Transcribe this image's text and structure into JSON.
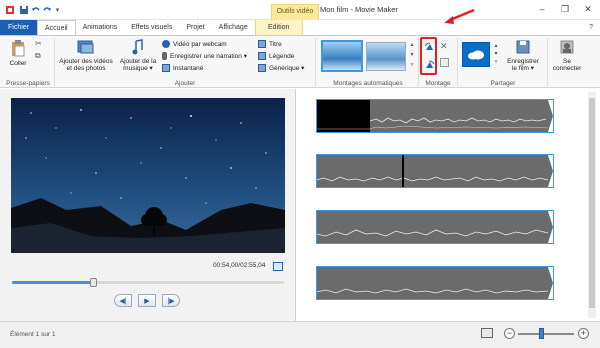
{
  "window": {
    "title": "Mon film - Movie Maker",
    "context_label": "Outils vidéo",
    "controls": [
      "–",
      "❐",
      "✕"
    ],
    "help": "?"
  },
  "tabs": {
    "file": "Fichier",
    "home": "Accueil",
    "animations": "Animations",
    "visual_effects": "Effets visuels",
    "project": "Projet",
    "view": "Affichage",
    "edit": "Edition"
  },
  "ribbon": {
    "clipboard": {
      "paste": "Coller",
      "label": "Presse-papiers"
    },
    "add": {
      "add_videos": [
        "Ajouter des vidéos",
        "et des photos"
      ],
      "add_music": [
        "Ajouter de la",
        "musique ▾"
      ],
      "webcam": "Vidéo par webcam",
      "narration": "Enregistrer une narration ▾",
      "snapshot": "Instantané",
      "title": "Titre",
      "caption": "Légende",
      "credits": "Générique ▾",
      "label": "Ajouter"
    },
    "automovie": {
      "label": "Montages automatiques"
    },
    "editing": {
      "label": "Montage"
    },
    "share": {
      "save_movie": [
        "Enregistrer",
        "le film ▾"
      ],
      "label": "Partager"
    },
    "signin": {
      "text": [
        "Se",
        "connecter"
      ]
    }
  },
  "player": {
    "timecode": "00:54,00/02:55,04",
    "progress": 0.3,
    "prev_label": "◀|",
    "play_label": "▶",
    "next_label": "|▶"
  },
  "status": {
    "text": "Élément 1 sur 1",
    "zoom_minus": "−",
    "zoom_plus": "+"
  },
  "colors": {
    "accent": "#1a5fb4",
    "highlight": "#e02020",
    "clip_border": "#3c9be0"
  }
}
